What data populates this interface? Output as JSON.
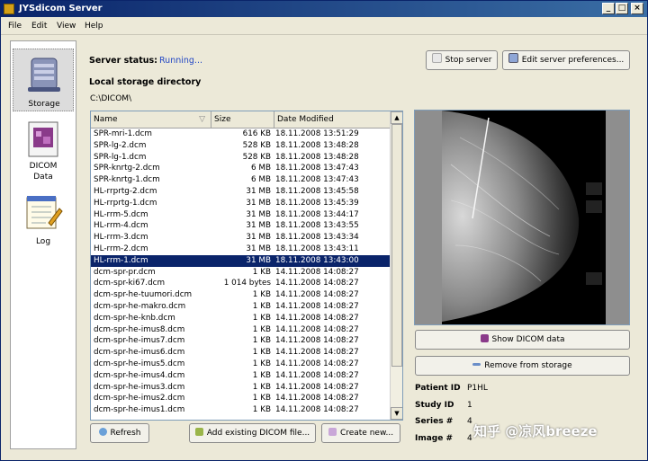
{
  "window": {
    "title": "JYSdicom Server"
  },
  "menu": [
    "File",
    "Edit",
    "View",
    "Help"
  ],
  "sidebar": {
    "items": [
      {
        "label": "Storage",
        "icon": "storage-server-icon"
      },
      {
        "label": "DICOM",
        "label2": "Data",
        "icon": "dicom-data-icon"
      },
      {
        "label": "Log",
        "icon": "log-notepad-icon"
      }
    ]
  },
  "server": {
    "status_label": "Server status:",
    "status_value": "Running...",
    "stop_label": "Stop server",
    "prefs_label": "Edit server preferences..."
  },
  "storage": {
    "heading": "Local storage directory",
    "path": "C:\\DICOM\\"
  },
  "table": {
    "columns": [
      "Name",
      "Size",
      "Date Modified"
    ],
    "selected_index": 11,
    "rows": [
      {
        "name": "SPR-mri-1.dcm",
        "size": "616 KB",
        "date": "18.11.2008 13:51:29"
      },
      {
        "name": "SPR-lg-2.dcm",
        "size": "528 KB",
        "date": "18.11.2008 13:48:28"
      },
      {
        "name": "SPR-lg-1.dcm",
        "size": "528 KB",
        "date": "18.11.2008 13:48:28"
      },
      {
        "name": "SPR-knrtg-2.dcm",
        "size": "6 MB",
        "date": "18.11.2008 13:47:43"
      },
      {
        "name": "SPR-knrtg-1.dcm",
        "size": "6 MB",
        "date": "18.11.2008 13:47:43"
      },
      {
        "name": "HL-rrprtg-2.dcm",
        "size": "31 MB",
        "date": "18.11.2008 13:45:58"
      },
      {
        "name": "HL-rrprtg-1.dcm",
        "size": "31 MB",
        "date": "18.11.2008 13:45:39"
      },
      {
        "name": "HL-rrm-5.dcm",
        "size": "31 MB",
        "date": "18.11.2008 13:44:17"
      },
      {
        "name": "HL-rrm-4.dcm",
        "size": "31 MB",
        "date": "18.11.2008 13:43:55"
      },
      {
        "name": "HL-rrm-3.dcm",
        "size": "31 MB",
        "date": "18.11.2008 13:43:34"
      },
      {
        "name": "HL-rrm-2.dcm",
        "size": "31 MB",
        "date": "18.11.2008 13:43:11"
      },
      {
        "name": "HL-rrm-1.dcm",
        "size": "31 MB",
        "date": "18.11.2008 13:43:00"
      },
      {
        "name": "dcm-spr-pr.dcm",
        "size": "1 KB",
        "date": "14.11.2008 14:08:27"
      },
      {
        "name": "dcm-spr-ki67.dcm",
        "size": "1 014 bytes",
        "date": "14.11.2008 14:08:27"
      },
      {
        "name": "dcm-spr-he-tuumori.dcm",
        "size": "1 KB",
        "date": "14.11.2008 14:08:27"
      },
      {
        "name": "dcm-spr-he-makro.dcm",
        "size": "1 KB",
        "date": "14.11.2008 14:08:27"
      },
      {
        "name": "dcm-spr-he-knb.dcm",
        "size": "1 KB",
        "date": "14.11.2008 14:08:27"
      },
      {
        "name": "dcm-spr-he-imus8.dcm",
        "size": "1 KB",
        "date": "14.11.2008 14:08:27"
      },
      {
        "name": "dcm-spr-he-imus7.dcm",
        "size": "1 KB",
        "date": "14.11.2008 14:08:27"
      },
      {
        "name": "dcm-spr-he-imus6.dcm",
        "size": "1 KB",
        "date": "14.11.2008 14:08:27"
      },
      {
        "name": "dcm-spr-he-imus5.dcm",
        "size": "1 KB",
        "date": "14.11.2008 14:08:27"
      },
      {
        "name": "dcm-spr-he-imus4.dcm",
        "size": "1 KB",
        "date": "14.11.2008 14:08:27"
      },
      {
        "name": "dcm-spr-he-imus3.dcm",
        "size": "1 KB",
        "date": "14.11.2008 14:08:27"
      },
      {
        "name": "dcm-spr-he-imus2.dcm",
        "size": "1 KB",
        "date": "14.11.2008 14:08:27"
      },
      {
        "name": "dcm-spr-he-imus1.dcm",
        "size": "1 KB",
        "date": "14.11.2008 14:08:27"
      }
    ]
  },
  "buttons": {
    "refresh": "Refresh",
    "add_existing": "Add existing DICOM file...",
    "create_new": "Create new...",
    "show_dicom": "Show DICOM data",
    "remove": "Remove from storage"
  },
  "patient_info": {
    "patient_id_label": "Patient ID",
    "patient_id": "P1HL",
    "study_id_label": "Study ID",
    "study_id": "1",
    "series_label": "Series #",
    "series": "4",
    "image_label": "Image #",
    "image": "4"
  },
  "watermark": "知乎 @凉风breeze",
  "colors": {
    "selection": "#0a246a",
    "status_running": "#2448c4",
    "title_bar": "#0a246a"
  }
}
